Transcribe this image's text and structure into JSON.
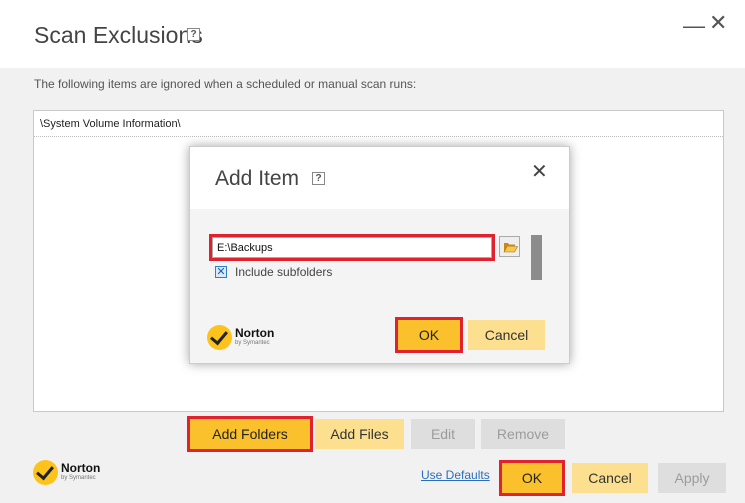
{
  "window": {
    "title": "Scan Exclusions",
    "help_glyph": "?",
    "minimize_glyph": "—",
    "close_glyph": "✕"
  },
  "description": "The following items are ignored when a scheduled or manual scan runs:",
  "exclusions": [
    "\\System Volume Information\\"
  ],
  "buttons": {
    "add_folders": "Add Folders",
    "add_files": "Add Files",
    "edit": "Edit",
    "remove": "Remove",
    "use_defaults": "Use Defaults",
    "ok": "OK",
    "cancel": "Cancel",
    "apply": "Apply"
  },
  "brand": {
    "name": "Norton",
    "sub": "by Symantec"
  },
  "dialog": {
    "title": "Add Item",
    "help_glyph": "?",
    "close_glyph": "✕",
    "path_value": "E:\\Backups",
    "include_subfolders_label": "Include subfolders",
    "include_subfolders_checked": true,
    "check_glyph": "✕",
    "ok": "OK",
    "cancel": "Cancel"
  },
  "icons": {
    "folder": "folder-open-icon",
    "brand_logo": "norton-check-icon"
  },
  "colors": {
    "primary": "#fbc12c",
    "secondary": "#fde08f",
    "disabled": "#dedede",
    "highlight": "#e0212e",
    "link": "#2a6ebb"
  }
}
